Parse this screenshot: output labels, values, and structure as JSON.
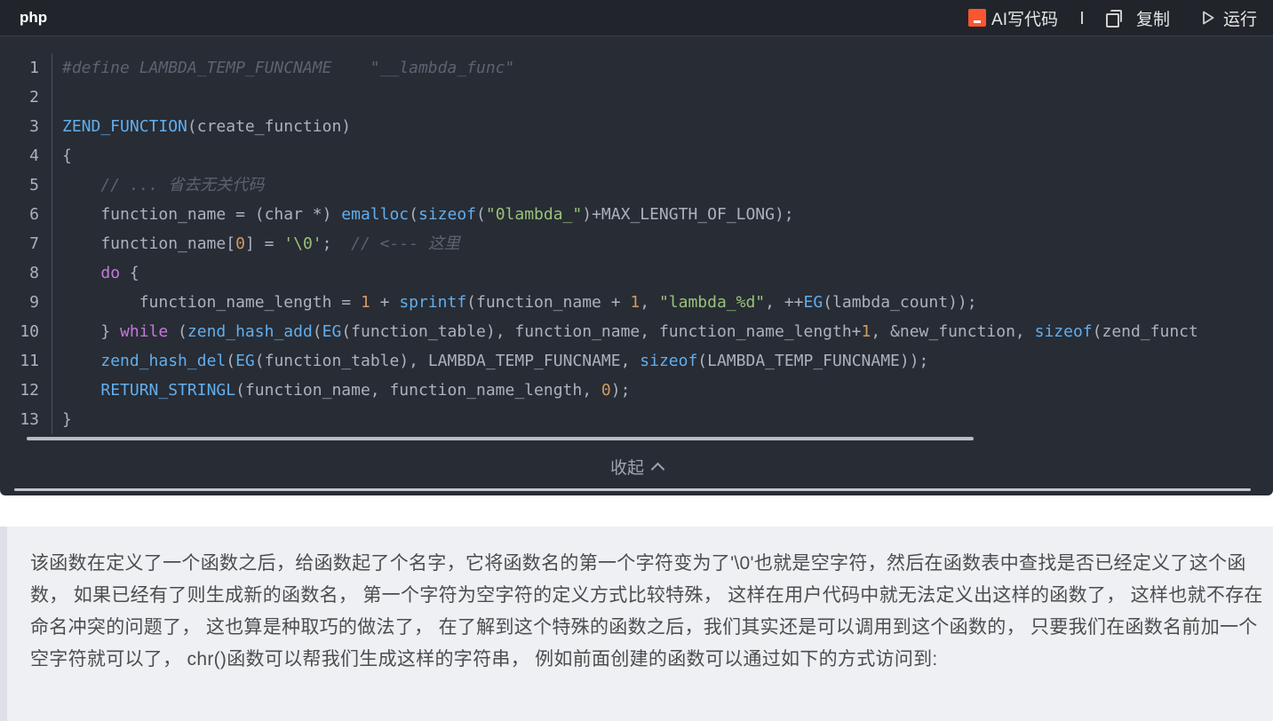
{
  "header": {
    "language": "php",
    "ai_label": "AI写代码",
    "copy_label": "复制",
    "run_label": "运行"
  },
  "code": {
    "line_numbers": [
      "1",
      "2",
      "3",
      "4",
      "5",
      "6",
      "7",
      "8",
      "9",
      "10",
      "11",
      "12",
      "13"
    ],
    "lines": [
      [
        {
          "t": "#define LAMBDA_TEMP_FUNCNAME    ",
          "c": "c"
        },
        {
          "t": "\"__lambda_func\"",
          "c": "c"
        }
      ],
      [],
      [
        {
          "t": "ZEND_FUNCTION",
          "c": "f"
        },
        {
          "t": "(create_function)",
          "c": "p"
        }
      ],
      [
        {
          "t": "{",
          "c": "p"
        }
      ],
      [
        {
          "t": "    ",
          "c": "p"
        },
        {
          "t": "// ... 省去无关代码",
          "c": "c"
        }
      ],
      [
        {
          "t": "    function_name = (char *) ",
          "c": "p"
        },
        {
          "t": "emalloc",
          "c": "f"
        },
        {
          "t": "(",
          "c": "p"
        },
        {
          "t": "sizeof",
          "c": "f"
        },
        {
          "t": "(",
          "c": "p"
        },
        {
          "t": "\"0lambda_\"",
          "c": "s"
        },
        {
          "t": ")+MAX_LENGTH_OF_LONG);",
          "c": "p"
        }
      ],
      [
        {
          "t": "    function_name[",
          "c": "p"
        },
        {
          "t": "0",
          "c": "n"
        },
        {
          "t": "] = ",
          "c": "p"
        },
        {
          "t": "'\\0'",
          "c": "s"
        },
        {
          "t": ";  ",
          "c": "p"
        },
        {
          "t": "// <--- 这里",
          "c": "c"
        }
      ],
      [
        {
          "t": "    ",
          "c": "p"
        },
        {
          "t": "do",
          "c": "k"
        },
        {
          "t": " {",
          "c": "p"
        }
      ],
      [
        {
          "t": "        function_name_length = ",
          "c": "p"
        },
        {
          "t": "1",
          "c": "n"
        },
        {
          "t": " + ",
          "c": "p"
        },
        {
          "t": "sprintf",
          "c": "f"
        },
        {
          "t": "(function_name + ",
          "c": "p"
        },
        {
          "t": "1",
          "c": "n"
        },
        {
          "t": ", ",
          "c": "p"
        },
        {
          "t": "\"lambda_%d\"",
          "c": "s"
        },
        {
          "t": ", ++",
          "c": "p"
        },
        {
          "t": "EG",
          "c": "f"
        },
        {
          "t": "(lambda_count));",
          "c": "p"
        }
      ],
      [
        {
          "t": "    } ",
          "c": "p"
        },
        {
          "t": "while",
          "c": "k"
        },
        {
          "t": " (",
          "c": "p"
        },
        {
          "t": "zend_hash_add",
          "c": "f"
        },
        {
          "t": "(",
          "c": "p"
        },
        {
          "t": "EG",
          "c": "f"
        },
        {
          "t": "(function_table), function_name, function_name_length+",
          "c": "p"
        },
        {
          "t": "1",
          "c": "n"
        },
        {
          "t": ", &new_function, ",
          "c": "p"
        },
        {
          "t": "sizeof",
          "c": "f"
        },
        {
          "t": "(zend_funct",
          "c": "p"
        }
      ],
      [
        {
          "t": "    ",
          "c": "p"
        },
        {
          "t": "zend_hash_del",
          "c": "f"
        },
        {
          "t": "(",
          "c": "p"
        },
        {
          "t": "EG",
          "c": "f"
        },
        {
          "t": "(function_table), LAMBDA_TEMP_FUNCNAME, ",
          "c": "p"
        },
        {
          "t": "sizeof",
          "c": "f"
        },
        {
          "t": "(LAMBDA_TEMP_FUNCNAME));",
          "c": "p"
        }
      ],
      [
        {
          "t": "    ",
          "c": "p"
        },
        {
          "t": "RETURN_STRINGL",
          "c": "f"
        },
        {
          "t": "(function_name, function_name_length, ",
          "c": "p"
        },
        {
          "t": "0",
          "c": "n"
        },
        {
          "t": ");",
          "c": "p"
        }
      ],
      [
        {
          "t": "}",
          "c": "p"
        }
      ]
    ]
  },
  "collapse_label": "收起",
  "paragraph": "该函数在定义了一个函数之后，给函数起了个名字，它将函数名的第一个字符变为了'\\0'也就是空字符，然后在函数表中查找是否已经定义了这个函数， 如果已经有了则生成新的函数名， 第一个字符为空字符的定义方式比较特殊， 这样在用户代码中就无法定义出这样的函数了， 这样也就不存在命名冲突的问题了， 这也算是种取巧的做法了， 在了解到这个特殊的函数之后，我们其实还是可以调用到这个函数的， 只要我们在函数名前加一个空字符就可以了， chr()函数可以帮我们生成这样的字符串， 例如前面创建的函数可以通过如下的方式访问到:",
  "colors": {
    "code_bg": "#282c34",
    "comment": "#5c6370",
    "string": "#98c379",
    "keyword": "#c678dd",
    "function": "#61aeee",
    "number": "#d19a66",
    "brand": "#fc5531"
  }
}
